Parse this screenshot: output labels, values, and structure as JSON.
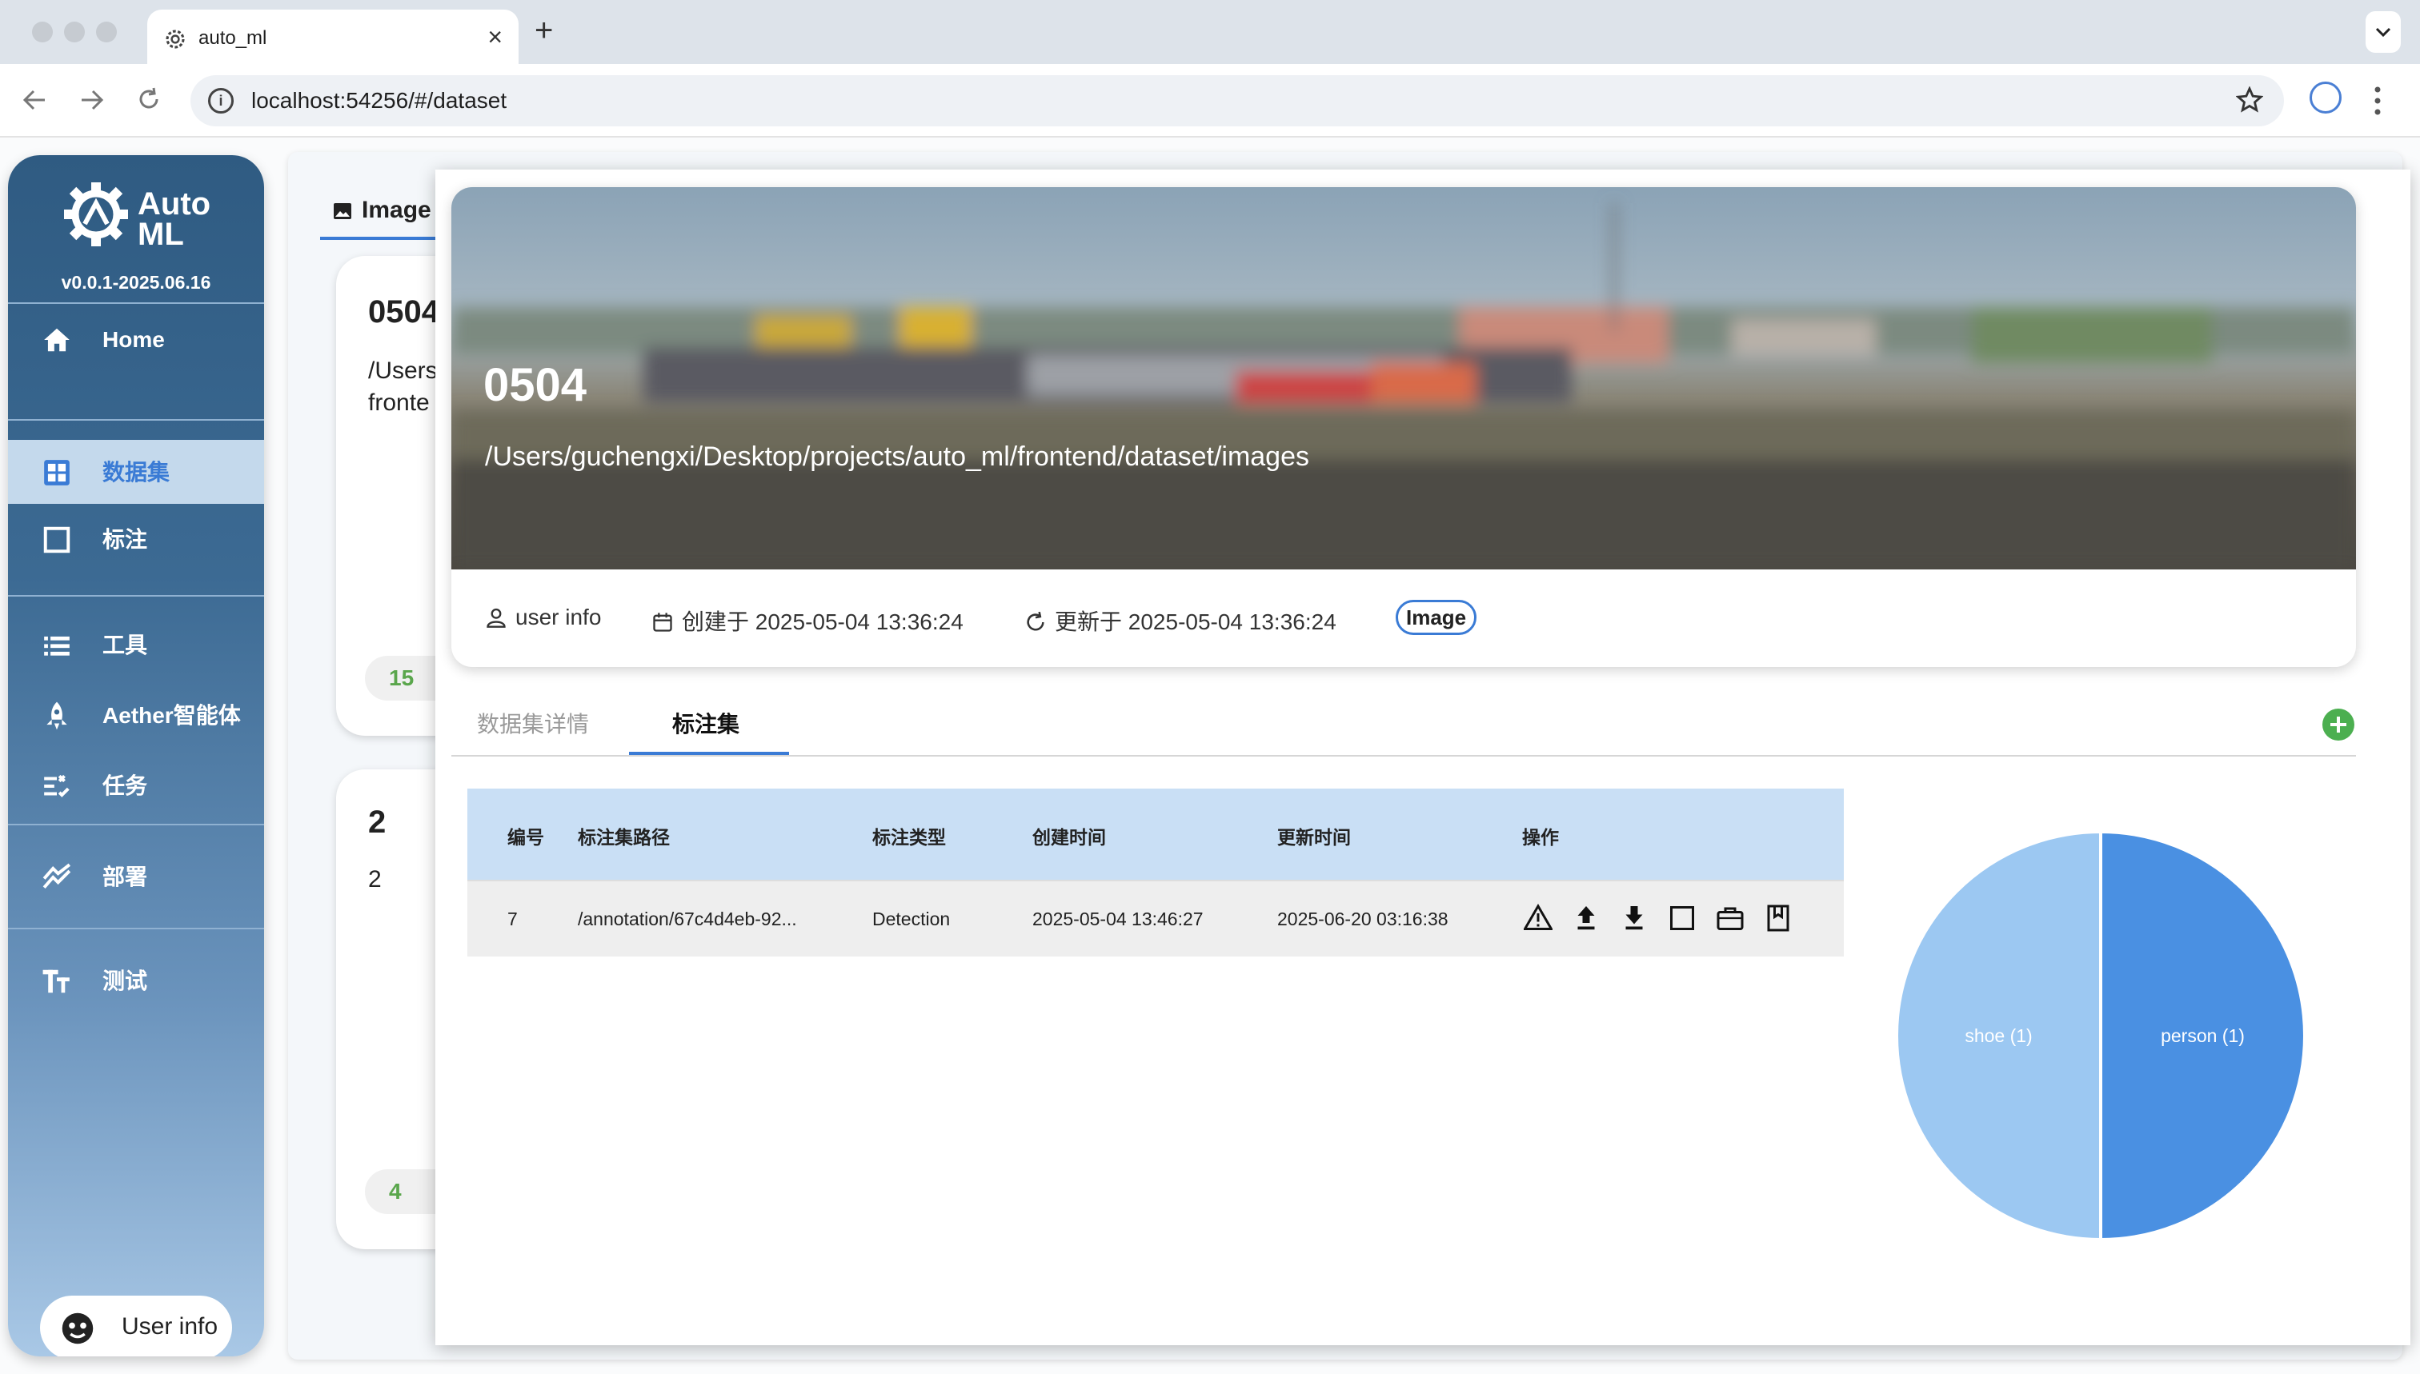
{
  "browser": {
    "tab_title": "auto_ml",
    "tab_close": "×",
    "new_tab": "+",
    "url": "localhost:54256/#/dataset"
  },
  "sidebar": {
    "logo_line1": "Auto",
    "logo_line2": "ML",
    "version": "v0.0.1-2025.06.16",
    "items": [
      {
        "label": "Home",
        "icon": "home-icon"
      },
      {
        "label": "数据集",
        "icon": "grid-icon"
      },
      {
        "label": "标注",
        "icon": "square-icon"
      },
      {
        "label": "工具",
        "icon": "list-icon"
      },
      {
        "label": "Aether智能体",
        "icon": "rocket-icon"
      },
      {
        "label": "任务",
        "icon": "task-icon"
      },
      {
        "label": "部署",
        "icon": "deploy-icon"
      },
      {
        "label": "测试",
        "icon": "text-icon"
      }
    ],
    "user_label": "User info"
  },
  "background": {
    "tab_label": "Image",
    "cards": [
      {
        "title": "0504",
        "text1": "/Users",
        "text2": "fronte",
        "pill": "15"
      },
      {
        "title": "2",
        "text1": "2",
        "text2": "",
        "pill": "4"
      }
    ]
  },
  "dataset": {
    "name": "0504",
    "path": "/Users/guchengxi/Desktop/projects/auto_ml/frontend/dataset/images",
    "user": "user info",
    "created": "创建于 2025-05-04 13:36:24",
    "updated": "更新于 2025-05-04 13:36:24",
    "type_badge": "Image"
  },
  "tabs": [
    {
      "label": "数据集详情",
      "active": false
    },
    {
      "label": "标注集",
      "active": true
    }
  ],
  "table": {
    "headers": [
      "编号",
      "标注集路径",
      "标注类型",
      "创建时间",
      "更新时间",
      "操作"
    ],
    "rows": [
      {
        "id": "7",
        "path": "/annotation/67c4d4eb-92...",
        "type": "Detection",
        "created": "2025-05-04 13:46:27",
        "updated": "2025-06-20 03:16:38",
        "actions": [
          "warning-icon",
          "upload-icon",
          "download-icon",
          "square-icon",
          "briefcase-icon",
          "bookmark-icon"
        ]
      }
    ]
  },
  "chart_data": {
    "type": "pie",
    "labels": [
      "person (1)",
      "shoe (1)"
    ],
    "values": [
      1,
      1
    ],
    "colors": [
      "#4a90e2",
      "#9cc8f2"
    ]
  },
  "colors": {
    "accent": "#3a7bd5",
    "sidebar_top": "#2f5b82",
    "add_button": "#4caf50"
  }
}
